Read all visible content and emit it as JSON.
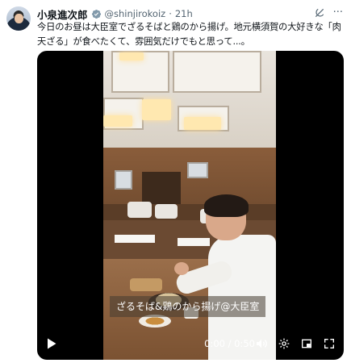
{
  "tweet": {
    "author_name": "小泉進次郎",
    "handle": "@shinjirokoiz",
    "separator": "·",
    "time": "21h",
    "text": "今日のお昼は大臣室でざるそばと鶏のから揚げ。地元横須賀の大好きな「肉天ざる」が食べたくて、雰囲気だけでもと思って...。"
  },
  "video": {
    "caption": "ざるそば&鶏のから揚げ@大臣室",
    "time_readout": "0:00 / 0:50"
  },
  "icons": {
    "verified": "verified-badge-icon",
    "grok": "grok-icon",
    "more": "more-icon",
    "play": "play-icon",
    "volume": "volume-icon",
    "settings": "settings-icon",
    "pip": "picture-in-picture-icon",
    "fullscreen": "fullscreen-icon"
  },
  "colors": {
    "verified": "#829aab",
    "muted": "#536471"
  }
}
